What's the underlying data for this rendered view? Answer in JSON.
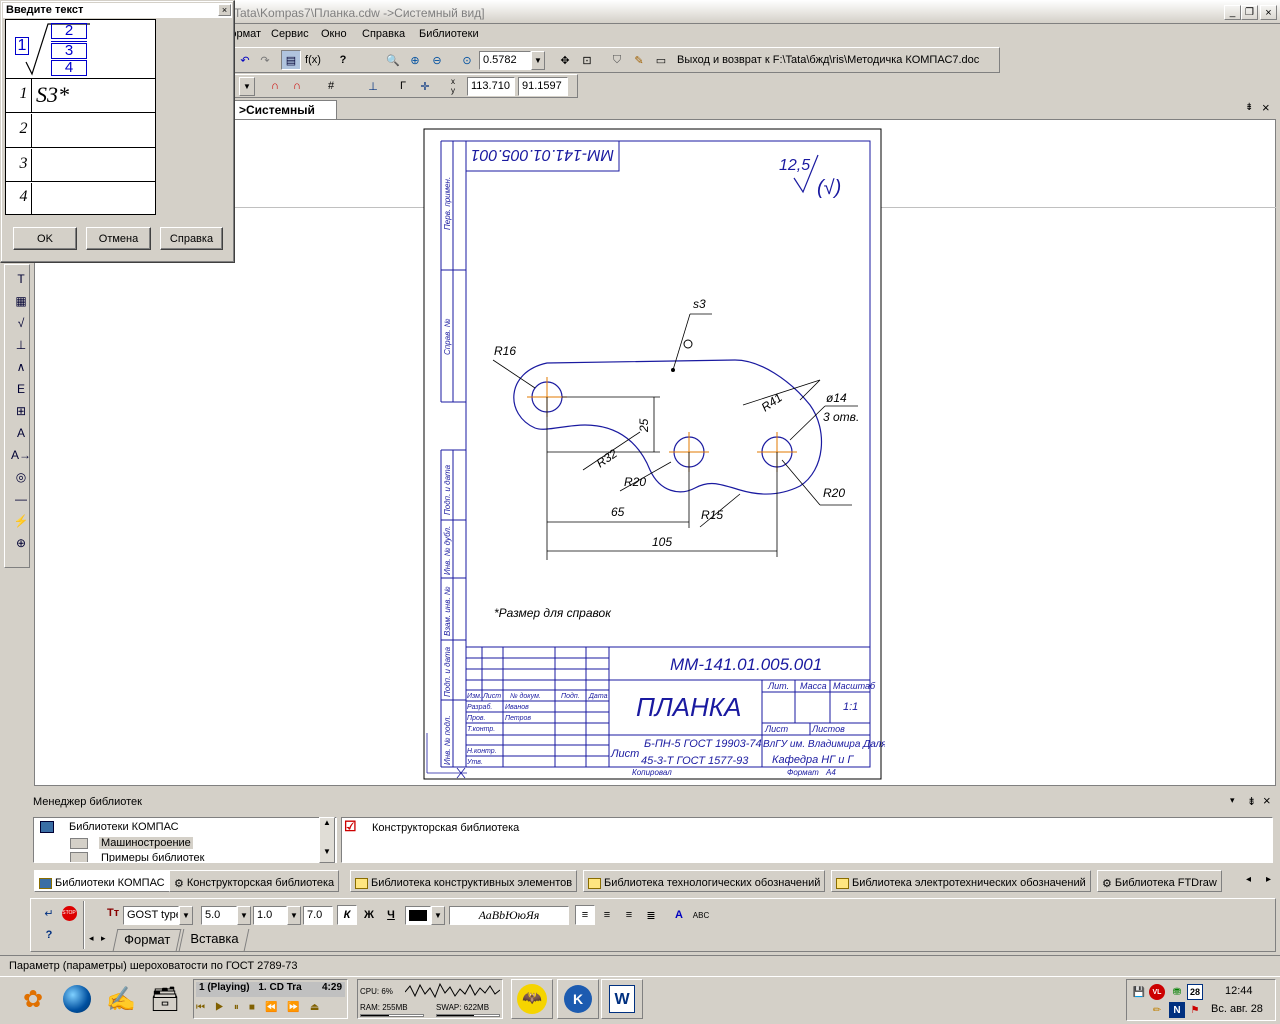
{
  "window": {
    "title": "Tata\\Kompas7\\Планка.cdw ->Системный вид]",
    "controls": [
      "_",
      "❐",
      "×"
    ]
  },
  "menu": {
    "items": [
      "Формат",
      "Сервис",
      "Окно",
      "Справка",
      "Библиотеки"
    ]
  },
  "toolbar": {
    "zoom_value": "0.5782",
    "return_link": "Выход и возврат к F:\\Tata\\бжд\\ris\\Методичка КОМПАС7.doc",
    "coord_x": "113.710",
    "coord_y": "91.1597"
  },
  "doc_tab": {
    "label": ">Системный вид"
  },
  "dialog": {
    "title": "Введите текст",
    "roughness_top": "2",
    "roughness_mid": "3",
    "roughness_bottom": "4",
    "roughness_left": "1",
    "rows": [
      {
        "num": "1",
        "value": "S3*"
      },
      {
        "num": "2",
        "value": ""
      },
      {
        "num": "3",
        "value": ""
      },
      {
        "num": "4",
        "value": ""
      }
    ],
    "buttons": {
      "ok": "OK",
      "cancel": "Отмена",
      "help": "Справка"
    }
  },
  "drawing": {
    "code": "ММ-141.01.005.001",
    "code_rotated": "ММ-141.01.005.001",
    "roughness": "12,5",
    "roughness_paren": "(√)",
    "name": "ПЛАНКА",
    "note": "*Размер для справок",
    "surface_label": "s3",
    "dims": {
      "r16": "R16",
      "r41": "R41",
      "d14": "ø14",
      "holes": "3 отв.",
      "d25": "25",
      "r32": "R32",
      "r20a": "R20",
      "r20b": "R20",
      "r15": "R15",
      "d65": "65",
      "d105": "105"
    },
    "side_labels": [
      "Перв. примен.",
      "Справ. №",
      "Подп. и дата",
      "Инв. № дубл.",
      "Взам. инв. №",
      "Подп. и дата",
      "Инв. № подл."
    ],
    "title_block": {
      "lit": "Лит.",
      "mass": "Масса",
      "scale": "Масштаб",
      "scale_value": "1:1",
      "sheet": "Лист",
      "sheets": "Листов",
      "material1": "Б-ПН-5 ГОСТ 19903-74",
      "material2": "45-3-Т ГОСТ 1577-93",
      "org1": "ВлГУ им. Владимира Даля",
      "org2": "Кафедра НГ и Г",
      "copied": "Копировал",
      "format": "Формат",
      "format_value": "A4",
      "rows": [
        "Изм.",
        "Лист",
        "№ докум.",
        "Подп.",
        "Дата"
      ],
      "roles": [
        "Разраб.",
        "Пров.",
        "Т.контр.",
        "",
        "Н.контр.",
        "Утв."
      ],
      "names": [
        "Иванов",
        "Петров"
      ]
    }
  },
  "library_manager": {
    "title": "Менеджер библиотек",
    "tree_root": "Библиотеки КОМПАС",
    "tree_items": [
      "Машиностроение",
      "Примеры библиотек"
    ],
    "right_item": "Конструкторская библиотека",
    "tabs": [
      "Библиотеки КОМПАС",
      "Конструкторская библиотека",
      "Библиотека конструктивных элементов",
      "Библиотека технологических обозначений",
      "Библиотека электротехнических обозначений",
      "Библиотека FTDraw"
    ]
  },
  "text_toolbar": {
    "font": "GOST type",
    "size": "5.0",
    "ratio": "1.0",
    "spacing": "7.0",
    "italic": "К",
    "bold": "Ж",
    "underline": "Ч",
    "sample": "АаВbЮюЯя",
    "tabs": [
      "Формат",
      "Вставка"
    ]
  },
  "status_bar": {
    "text": "Параметр (параметры) шероховатости по ГОСТ 2789-73"
  },
  "taskbar": {
    "player_track": "1 (Playing)",
    "player_title": "1. CD Tra",
    "player_time": "4:29",
    "cpu": "CPU: 6%",
    "ram": "RAM: 255MB",
    "swap": "SWAP: 622MB",
    "clock": "12:44",
    "date": "Вс. авг. 28",
    "calendar_day": "28"
  },
  "colors": {
    "drawing_blue": "#1a1aa0",
    "center_orange": "#e07800",
    "titlebar": "#0a246a",
    "dialog_blue": "#0000cc"
  }
}
